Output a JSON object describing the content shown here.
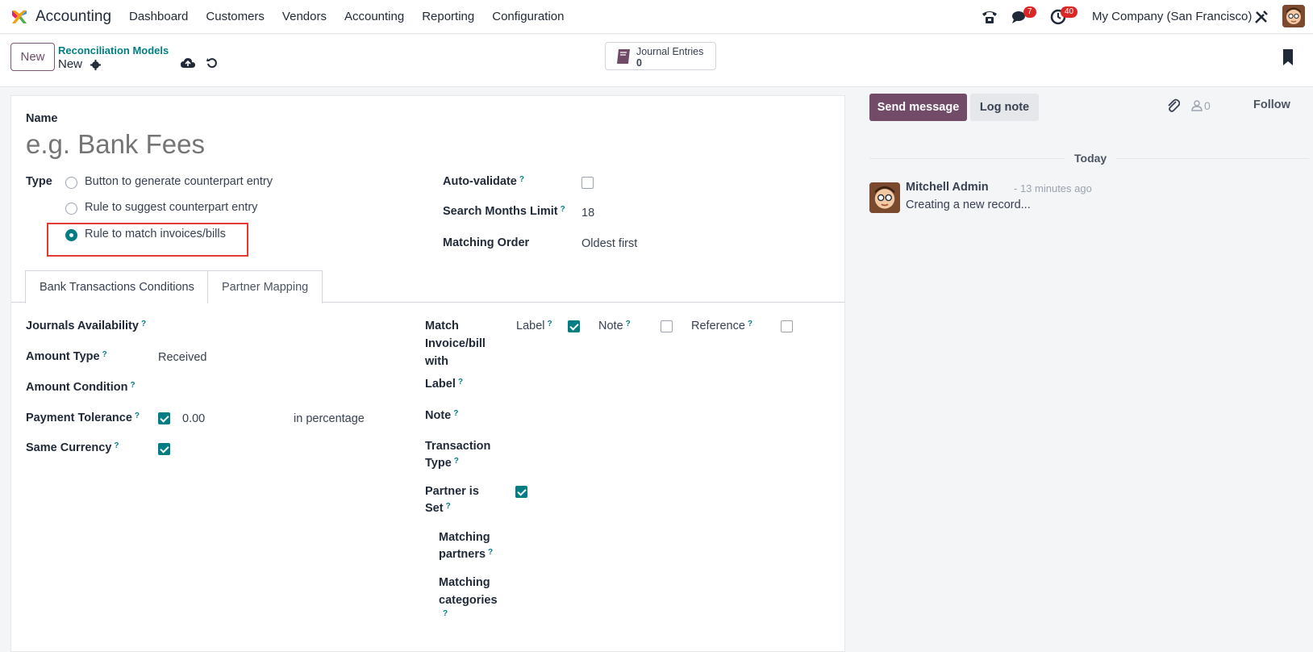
{
  "app": {
    "name": "Accounting"
  },
  "menu": [
    "Dashboard",
    "Customers",
    "Vendors",
    "Accounting",
    "Reporting",
    "Configuration"
  ],
  "systray": {
    "messages_count": "7",
    "activities_count": "40",
    "company": "My Company (San Francisco)"
  },
  "control": {
    "new_label": "New",
    "breadcrumb_parent": "Reconciliation Models",
    "breadcrumb_current": "New",
    "smart_button": {
      "label": "Journal Entries",
      "value": "0"
    }
  },
  "form": {
    "name_label": "Name",
    "name_placeholder": "e.g. Bank Fees",
    "type_label": "Type",
    "type_options": [
      "Button to generate counterpart entry",
      "Rule to suggest counterpart entry",
      "Rule to match invoices/bills"
    ],
    "type_selected": "Rule to match invoices/bills",
    "auto_validate_label": "Auto-validate",
    "auto_validate": false,
    "search_months_label": "Search Months Limit",
    "search_months_value": "18",
    "matching_order_label": "Matching Order",
    "matching_order_value": "Oldest first",
    "help_mark": "?"
  },
  "tabs": [
    "Bank Transactions Conditions",
    "Partner Mapping"
  ],
  "conditions": {
    "journals_label": "Journals Availability",
    "amount_type_label": "Amount Type",
    "amount_type_value": "Received",
    "amount_condition_label": "Amount Condition",
    "payment_tolerance_label": "Payment Tolerance",
    "payment_tolerance_checked": true,
    "payment_tolerance_value": "0.00",
    "payment_tolerance_unit": "in percentage",
    "same_currency_label": "Same Currency",
    "same_currency_checked": true,
    "match_with_label_1": "Match",
    "match_with_label_2": "Invoice/bill",
    "match_with_label_3": "with",
    "match_label_opt": "Label",
    "match_note_opt": "Note",
    "match_ref_opt": "Reference",
    "match_label_checked": true,
    "match_note_checked": false,
    "match_ref_checked": false,
    "label_label": "Label",
    "note_label": "Note",
    "transaction_type_label_1": "Transaction",
    "transaction_type_label_2": "Type",
    "partner_set_label_1": "Partner is",
    "partner_set_label_2": "Set",
    "partner_set_checked": true,
    "matching_partners_1": "Matching",
    "matching_partners_2": "partners",
    "matching_categories_1": "Matching",
    "matching_categories_2": "categories"
  },
  "chatter": {
    "send_label": "Send message",
    "log_label": "Log note",
    "followers_count": "0",
    "follow_label": "Follow",
    "today_label": "Today",
    "message": {
      "author": "Mitchell Admin",
      "time": "- 13 minutes ago",
      "body": "Creating a new record..."
    }
  },
  "colors": {
    "brand": "#714b67",
    "accent": "#017e84",
    "highlight": "#e53935"
  }
}
